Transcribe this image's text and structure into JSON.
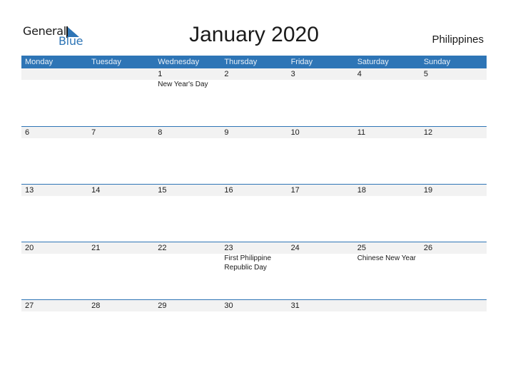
{
  "logo": {
    "line1": "General",
    "line2": "Blue"
  },
  "title": "January 2020",
  "country": "Philippines",
  "weekdays": [
    "Monday",
    "Tuesday",
    "Wednesday",
    "Thursday",
    "Friday",
    "Saturday",
    "Sunday"
  ],
  "weeks": [
    {
      "days": [
        "",
        "",
        "1",
        "2",
        "3",
        "4",
        "5"
      ],
      "events": [
        "",
        "",
        "New Year's Day",
        "",
        "",
        "",
        ""
      ]
    },
    {
      "days": [
        "6",
        "7",
        "8",
        "9",
        "10",
        "11",
        "12"
      ],
      "events": [
        "",
        "",
        "",
        "",
        "",
        "",
        ""
      ]
    },
    {
      "days": [
        "13",
        "14",
        "15",
        "16",
        "17",
        "18",
        "19"
      ],
      "events": [
        "",
        "",
        "",
        "",
        "",
        "",
        ""
      ]
    },
    {
      "days": [
        "20",
        "21",
        "22",
        "23",
        "24",
        "25",
        "26"
      ],
      "events": [
        "",
        "",
        "",
        "First Philippine Republic Day",
        "",
        "Chinese New Year",
        ""
      ]
    },
    {
      "days": [
        "27",
        "28",
        "29",
        "30",
        "31",
        "",
        ""
      ],
      "events": [
        "",
        "",
        "",
        "",
        "",
        "",
        ""
      ]
    }
  ],
  "colors": {
    "accent": "#2e75b6",
    "row_bg": "#f2f2f2"
  }
}
